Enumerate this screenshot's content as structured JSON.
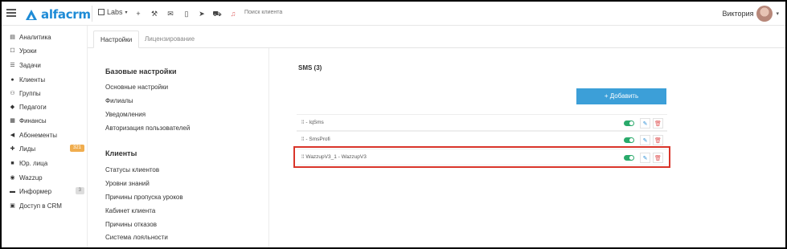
{
  "app": {
    "logo_text": "alfacrm",
    "brand_color": "#1e8bd6"
  },
  "topbar": {
    "labs_label": "Labs",
    "search_placeholder": "Поиск клиента",
    "user_name": "Виктория",
    "icons": [
      "burger-icon",
      "labs-icon",
      "plus-icon",
      "wrench-icon",
      "mail-icon",
      "phone-icon",
      "send-icon",
      "cart-icon",
      "bell-icon"
    ]
  },
  "sidebar": {
    "items": [
      {
        "label": "Аналитика",
        "icon": "analytics-icon"
      },
      {
        "label": "Уроки",
        "icon": "lessons-icon"
      },
      {
        "label": "Задачи",
        "icon": "tasks-icon"
      },
      {
        "label": "Клиенты",
        "icon": "user-icon"
      },
      {
        "label": "Группы",
        "icon": "group-icon"
      },
      {
        "label": "Педагоги",
        "icon": "graduation-icon"
      },
      {
        "label": "Финансы",
        "icon": "finance-icon"
      },
      {
        "label": "Абонементы",
        "icon": "tag-icon"
      },
      {
        "label": "Лиды",
        "icon": "lead-icon",
        "badge": "321"
      },
      {
        "label": "Юр. лица",
        "icon": "briefcase-icon"
      },
      {
        "label": "Wazzup",
        "icon": "whatsapp-icon"
      },
      {
        "label": "Информер",
        "icon": "informer-icon",
        "badge": "3"
      },
      {
        "label": "Доступ в CRM",
        "icon": "lock-icon"
      }
    ]
  },
  "tabs": [
    {
      "label": "Настройки",
      "active": true
    },
    {
      "label": "Лицензирование",
      "active": false
    }
  ],
  "settings": {
    "basic": {
      "title": "Базовые настройки",
      "links": [
        "Основные настройки",
        "Филиалы",
        "Уведомления",
        "Авторизация пользователей"
      ]
    },
    "clients": {
      "title": "Клиенты",
      "links": [
        "Статусы клиентов",
        "Уровни знаний",
        "Причины пропуска уроков",
        "Кабинет клиента",
        "Причины отказов",
        "Система лояльности"
      ]
    }
  },
  "sms": {
    "title": "SMS (3)",
    "add_label": "+ Добавить",
    "accent": "#3c9fd8",
    "rows": [
      {
        "label": "IqSms",
        "enabled": true
      },
      {
        "label": "SmsProfi",
        "enabled": true
      },
      {
        "label": "WazzupV3_1 - WazzupV3",
        "enabled": true,
        "highlighted": true
      }
    ]
  }
}
